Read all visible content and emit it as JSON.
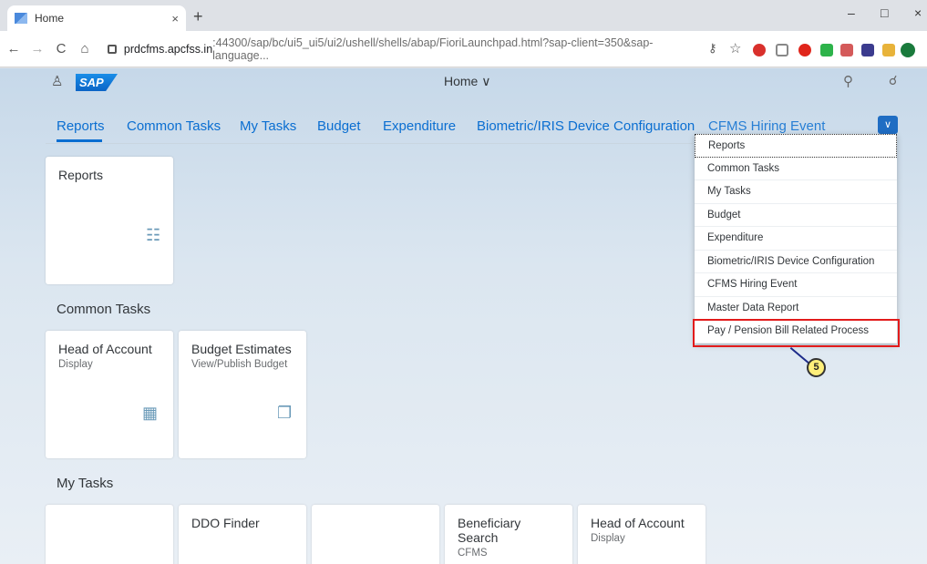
{
  "browser": {
    "tab_title": "Home",
    "tab_close": "×",
    "new_tab": "+",
    "url_host": "prdcfms.apcfss.in",
    "url_path": ":44300/sap/bc/ui5_ui5/ui2/ushell/shells/abap/FioriLaunchpad.html?sap-client=350&sap-language...",
    "minimize": "–",
    "maximize": "□",
    "close": "×"
  },
  "shell": {
    "logo": "SAP",
    "title": "Home ∨"
  },
  "anchor_bar": {
    "items": [
      "Reports",
      "Common Tasks",
      "My Tasks",
      "Budget",
      "Expenditure",
      "Biometric/IRIS Device Configuration",
      "CFMS Hiring Event"
    ]
  },
  "groups": {
    "reports_tile": "Reports",
    "common_tasks_title": "Common Tasks",
    "common_tiles": [
      {
        "title": "Head of Account",
        "subtitle": "Display"
      },
      {
        "title": "Budget Estimates",
        "subtitle": "View/Publish Budget"
      }
    ],
    "my_tasks_title": "My Tasks",
    "my_tiles": [
      {
        "title": "",
        "subtitle": ""
      },
      {
        "title": "DDO Finder",
        "subtitle": ""
      },
      {
        "title": "",
        "subtitle": ""
      },
      {
        "title": "Beneficiary Search",
        "subtitle": "CFMS"
      },
      {
        "title": "Head of Account",
        "subtitle": "Display"
      }
    ]
  },
  "dropdown": {
    "items": [
      "Reports",
      "Common Tasks",
      "My Tasks",
      "Budget",
      "Expenditure",
      "Biometric/IRIS Device Configuration",
      "CFMS Hiring Event",
      "Master Data Report",
      "Pay / Pension Bill Related Process"
    ]
  },
  "annotation": {
    "step": "5",
    "color": "#e21b1b"
  }
}
